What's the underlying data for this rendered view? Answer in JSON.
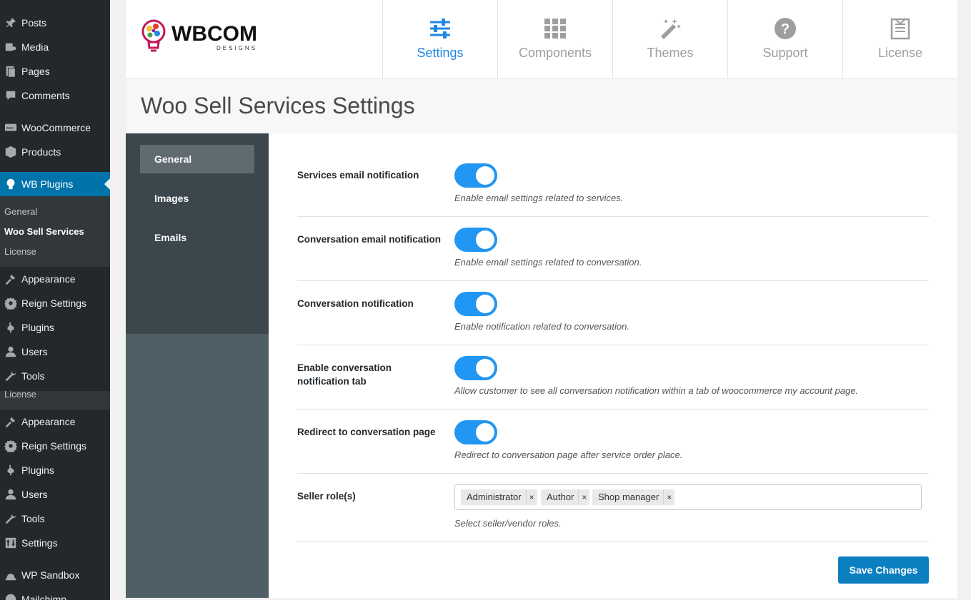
{
  "admin_menu": {
    "items": [
      {
        "label": "Posts",
        "icon": "pin-icon"
      },
      {
        "label": "Media",
        "icon": "media-icon"
      },
      {
        "label": "Pages",
        "icon": "pages-icon"
      },
      {
        "label": "Comments",
        "icon": "comments-icon"
      },
      {
        "label": "WooCommerce",
        "icon": "woocommerce-icon"
      },
      {
        "label": "Products",
        "icon": "products-icon"
      },
      {
        "label": "WB Plugins",
        "icon": "lightbulb-icon"
      },
      {
        "label": "Appearance",
        "icon": "appearance-icon"
      },
      {
        "label": "Reign Settings",
        "icon": "gear-icon"
      },
      {
        "label": "Plugins",
        "icon": "plugins-icon"
      },
      {
        "label": "Users",
        "icon": "users-icon"
      },
      {
        "label": "Tools",
        "icon": "tools-icon"
      },
      {
        "label": "Appearance",
        "icon": "appearance-icon"
      },
      {
        "label": "Reign Settings",
        "icon": "gear-icon"
      },
      {
        "label": "Plugins",
        "icon": "plugins-icon"
      },
      {
        "label": "Users",
        "icon": "users-icon"
      },
      {
        "label": "Tools",
        "icon": "tools-icon"
      },
      {
        "label": "Settings",
        "icon": "settings-icon"
      },
      {
        "label": "WP Sandbox",
        "icon": "sandbox-icon"
      },
      {
        "label": "Mailchimp",
        "icon": "mailchimp-icon"
      }
    ],
    "submenu": [
      "General",
      "Woo Sell Services",
      "License"
    ],
    "ghost_label": "License",
    "active_color": "#0073aa"
  },
  "header": {
    "logo_text": "WBCOM",
    "logo_sub": "DESIGNS",
    "tabs": [
      {
        "label": "Settings",
        "icon": "sliders-icon",
        "active": true
      },
      {
        "label": "Components",
        "icon": "grid-icon",
        "active": false
      },
      {
        "label": "Themes",
        "icon": "magic-wand-icon",
        "active": false
      },
      {
        "label": "Support",
        "icon": "question-icon",
        "active": false
      },
      {
        "label": "License",
        "icon": "license-icon",
        "active": false
      }
    ],
    "active_color": "#1e88e5"
  },
  "page_title": "Woo Sell Services Settings",
  "settings_nav": [
    "General",
    "Images",
    "Emails"
  ],
  "settings": [
    {
      "label": "Services email notification",
      "enabled": true,
      "description": "Enable email settings related to services."
    },
    {
      "label": "Conversation email notification",
      "enabled": true,
      "description": "Enable email settings related to conversation."
    },
    {
      "label": "Conversation notification",
      "enabled": true,
      "description": "Enable notification related to conversation."
    },
    {
      "label": "Enable conversation notification tab",
      "enabled": true,
      "description": "Allow customer to see all conversation notification within a tab of woocommerce my account page."
    },
    {
      "label": "Redirect to conversation page",
      "enabled": true,
      "description": "Redirect to conversation page after service order place."
    }
  ],
  "seller_roles": {
    "label": "Seller role(s)",
    "selected": [
      "Administrator",
      "Author",
      "Shop manager"
    ],
    "remove_glyph": "×",
    "description": "Select seller/vendor roles."
  },
  "save_label": "Save Changes",
  "toggle_color": "#2196f3"
}
